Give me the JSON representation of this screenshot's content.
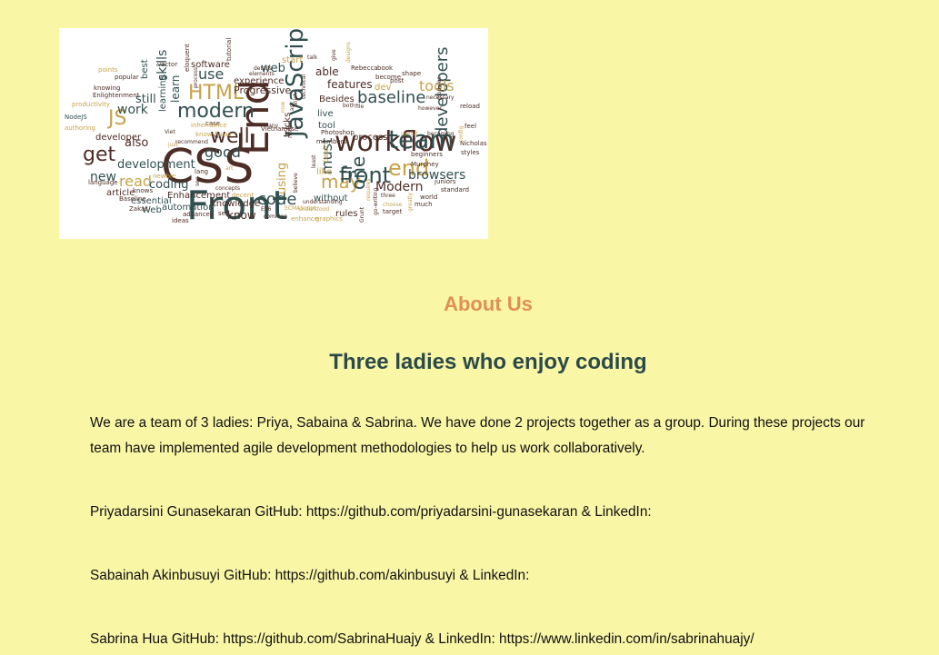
{
  "wordcloud": {
    "words": [
      {
        "text": "CSS",
        "color": "#4d2d26"
      },
      {
        "text": "Front",
        "color": "#324f4f"
      },
      {
        "text": "End",
        "color": "#4d2d26"
      },
      {
        "text": "workflow",
        "color": "#4d2d26"
      },
      {
        "text": "JavaScript",
        "color": "#324f4f"
      },
      {
        "text": "team",
        "color": "#324f4f"
      },
      {
        "text": "front",
        "color": "#324f4f"
      },
      {
        "text": "end",
        "color": "#c7a24a"
      },
      {
        "text": "developers",
        "color": "#324f4f"
      },
      {
        "text": "baseline",
        "color": "#324f4f"
      },
      {
        "text": "modern",
        "color": "#324f4f"
      },
      {
        "text": "HTML",
        "color": "#c7a24a"
      },
      {
        "text": "JS",
        "color": "#c7a24a"
      },
      {
        "text": "get",
        "color": "#4d2d26"
      },
      {
        "text": "well",
        "color": "#4d2d26"
      },
      {
        "text": "good",
        "color": "#324f4f"
      },
      {
        "text": "code",
        "color": "#324f4f"
      },
      {
        "text": "may",
        "color": "#c7a24a"
      },
      {
        "text": "one",
        "color": "#324f4f"
      },
      {
        "text": "browsers",
        "color": "#324f4f"
      },
      {
        "text": "Modern",
        "color": "#4d2d26"
      },
      {
        "text": "tools",
        "color": "#c7a24a"
      },
      {
        "text": "features",
        "color": "#4d2d26"
      },
      {
        "text": "skills",
        "color": "#324f4f"
      },
      {
        "text": "use",
        "color": "#324f4f"
      },
      {
        "text": "work",
        "color": "#324f4f"
      },
      {
        "text": "new",
        "color": "#324f4f"
      },
      {
        "text": "read",
        "color": "#c7a24a"
      },
      {
        "text": "also",
        "color": "#4d2d26"
      },
      {
        "text": "development",
        "color": "#324f4f"
      },
      {
        "text": "coding",
        "color": "#324f4f"
      },
      {
        "text": "must",
        "color": "#324f4f"
      },
      {
        "text": "UI",
        "color": "#324f4f"
      },
      {
        "text": "using",
        "color": "#c7a24a"
      },
      {
        "text": "web",
        "color": "#324f4f"
      },
      {
        "text": "learn",
        "color": "#324f4f"
      },
      {
        "text": "still",
        "color": "#324f4f"
      },
      {
        "text": "Progressive",
        "color": "#4d2d26"
      },
      {
        "text": "experience",
        "color": "#4d2d26"
      },
      {
        "text": "software",
        "color": "#4d2d26"
      },
      {
        "text": "process",
        "color": "#4d2d26"
      },
      {
        "text": "knowledge",
        "color": "#4d2d26"
      },
      {
        "text": "automation",
        "color": "#324f4f"
      },
      {
        "text": "Enhancement",
        "color": "#4d2d26"
      },
      {
        "text": "essential",
        "color": "#324f4f"
      },
      {
        "text": "article",
        "color": "#4d2d26"
      },
      {
        "text": "developer",
        "color": "#4d2d26"
      },
      {
        "text": "Besides",
        "color": "#4d2d26"
      },
      {
        "text": "know",
        "color": "#4d2d26"
      },
      {
        "text": "rules",
        "color": "#4d2d26"
      },
      {
        "text": "without",
        "color": "#324f4f"
      },
      {
        "text": "able",
        "color": "#4d2d26"
      },
      {
        "text": "start",
        "color": "#c7a24a"
      },
      {
        "text": "dev",
        "color": "#c7a24a"
      },
      {
        "text": "tricks",
        "color": "#4d2d26"
      },
      {
        "text": "like",
        "color": "#c7a24a"
      },
      {
        "text": "live",
        "color": "#324f4f"
      },
      {
        "text": "tool",
        "color": "#324f4f"
      },
      {
        "text": "Web",
        "color": "#324f4f"
      },
      {
        "text": "best",
        "color": "#324f4f"
      },
      {
        "text": "learning",
        "color": "#324f4f"
      },
      {
        "text": "Nicholas",
        "color": "#4d2d26"
      },
      {
        "text": "styles",
        "color": "#4d2d26"
      },
      {
        "text": "juniors",
        "color": "#4d2d26"
      },
      {
        "text": "Murphey",
        "color": "#4d2d26"
      },
      {
        "text": "beginners",
        "color": "#4d2d26"
      },
      {
        "text": "world",
        "color": "#4d2d26"
      },
      {
        "text": "much",
        "color": "#4d2d26"
      },
      {
        "text": "target",
        "color": "#4d2d26"
      },
      {
        "text": "Rebecca",
        "color": "#4d2d26"
      },
      {
        "text": "become",
        "color": "#4d2d26"
      },
      {
        "text": "post",
        "color": "#4d2d26"
      },
      {
        "text": "book",
        "color": "#4d2d26"
      },
      {
        "text": "shape",
        "color": "#4d2d26"
      },
      {
        "text": "Photoshop",
        "color": "#4d2d26"
      },
      {
        "text": "basic",
        "color": "#c7a24a"
      },
      {
        "text": "Grunt",
        "color": "#4d2d26"
      },
      {
        "text": "understood",
        "color": "#c7a24a"
      },
      {
        "text": "understanding",
        "color": "#4d2d26"
      },
      {
        "text": "graphics",
        "color": "#c7a24a"
      },
      {
        "text": "enhance",
        "color": "#c7a24a"
      },
      {
        "text": "common",
        "color": "#4d2d26"
      },
      {
        "text": "ES6",
        "color": "#4d2d26"
      },
      {
        "text": "ECMAScript",
        "color": "#c7a24a"
      },
      {
        "text": "decent",
        "color": "#c7a24a"
      },
      {
        "text": "set",
        "color": "#4d2d26"
      },
      {
        "text": "advanced",
        "color": "#4d2d26"
      },
      {
        "text": "ideas",
        "color": "#4d2d26"
      },
      {
        "text": "Zakas",
        "color": "#4d2d26"
      },
      {
        "text": "knows",
        "color": "#4d2d26"
      },
      {
        "text": "Baseline",
        "color": "#4d2d26"
      },
      {
        "text": "language",
        "color": "#4d2d26"
      },
      {
        "text": "newbie",
        "color": "#c7a24a"
      },
      {
        "text": "authoring",
        "color": "#c7a24a"
      },
      {
        "text": "NodeJS",
        "color": "#324f4f"
      },
      {
        "text": "productivity",
        "color": "#c7a24a"
      },
      {
        "text": "Enlightenment",
        "color": "#4d2d26"
      },
      {
        "text": "knowing",
        "color": "#4d2d26"
      },
      {
        "text": "popular",
        "color": "#4d2d26"
      },
      {
        "text": "vector",
        "color": "#4d2d26"
      },
      {
        "text": "points",
        "color": "#c7a24a"
      },
      {
        "text": "process",
        "color": "#4d2d26"
      },
      {
        "text": "eloquent",
        "color": "#4d2d26"
      },
      {
        "text": "tutorial",
        "color": "#4d2d26"
      },
      {
        "text": "details",
        "color": "#4d2d26"
      },
      {
        "text": "elements",
        "color": "#4d2d26"
      },
      {
        "text": "talk",
        "color": "#4d2d26"
      },
      {
        "text": "give",
        "color": "#4d2d26"
      },
      {
        "text": "designs",
        "color": "#c7a24a"
      },
      {
        "text": "modules",
        "color": "#4d2d26"
      },
      {
        "text": "however",
        "color": "#4d2d26"
      },
      {
        "text": "necessary",
        "color": "#4d2d26"
      },
      {
        "text": "reload",
        "color": "#4d2d26"
      },
      {
        "text": "feel",
        "color": "#4d2d26"
      },
      {
        "text": "config",
        "color": "#c7a24a"
      },
      {
        "text": "useful",
        "color": "#c7a24a"
      },
      {
        "text": "becoming",
        "color": "#4d2d26"
      },
      {
        "text": "standard",
        "color": "#4d2d26"
      },
      {
        "text": "three",
        "color": "#4d2d26"
      },
      {
        "text": "choose",
        "color": "#c7a24a"
      },
      {
        "text": "greatly",
        "color": "#c7a24a"
      },
      {
        "text": "go-writing",
        "color": "#4d2d26"
      },
      {
        "text": "requires",
        "color": "#c7a24a"
      },
      {
        "text": "lang",
        "color": "#4d2d26"
      },
      {
        "text": "art",
        "color": "#c7a24a"
      },
      {
        "text": "box",
        "color": "#4d2d26"
      },
      {
        "text": "Vietnamese",
        "color": "#4d2d26"
      },
      {
        "text": "Many",
        "color": "#4d2d26"
      },
      {
        "text": "make",
        "color": "#4d2d26"
      },
      {
        "text": "least",
        "color": "#4d2d26"
      },
      {
        "text": "believe",
        "color": "#4d2d26"
      },
      {
        "text": "members",
        "color": "#4d2d26"
      },
      {
        "text": "both",
        "color": "#4d2d26"
      },
      {
        "text": "file",
        "color": "#4d2d26"
      },
      {
        "text": "case",
        "color": "#4d2d26"
      },
      {
        "text": "know-hows",
        "color": "#c7a24a"
      },
      {
        "text": "recommend",
        "color": "#4d2d26"
      },
      {
        "text": "Viet",
        "color": "#4d2d26"
      },
      {
        "text": "just",
        "color": "#c7a24a"
      },
      {
        "text": "see",
        "color": "#4d2d26"
      },
      {
        "text": "now",
        "color": "#c7a24a"
      },
      {
        "text": "ask",
        "color": "#4d2d26"
      },
      {
        "text": "finish",
        "color": "#4d2d26"
      },
      {
        "text": "technical",
        "color": "#4d2d26"
      },
      {
        "text": "inheritance",
        "color": "#c7a24a"
      },
      {
        "text": "concepts",
        "color": "#4d2d26"
      },
      {
        "text": "pick",
        "color": "#4d2d26"
      },
      {
        "text": "from",
        "color": "#c7a24a"
      }
    ]
  },
  "about": {
    "heading": "About Us",
    "subheading": "Three ladies who enjoy coding",
    "intro": "We are a team of 3 ladies: Priya, Sabaina & Sabrina. We have done 2 projects together as a group. During these projects our team have implemented agile development methodologies to help us work collaboratively."
  },
  "members": [
    {
      "name_prefix": "Priyadarsini Gunasekaran GitHub: ",
      "github": "https://github.com/priyadarsini-gunasekaran",
      "linkedin_prefix": " & LinkedIn:",
      "linkedin": ""
    },
    {
      "name_prefix": "Sabainah Akinbusuyi GitHub: ",
      "github": "https://github.com/akinbusuyi",
      "linkedin_prefix": " & LinkedIn:",
      "linkedin": ""
    },
    {
      "name_prefix": "Sabrina Hua GitHub: ",
      "github": "https://github.com/SabrinaHuajy",
      "linkedin_prefix": " & LinkedIn: ",
      "linkedin": "https://www.linkedin.com/in/sabrinahuajy/"
    }
  ]
}
